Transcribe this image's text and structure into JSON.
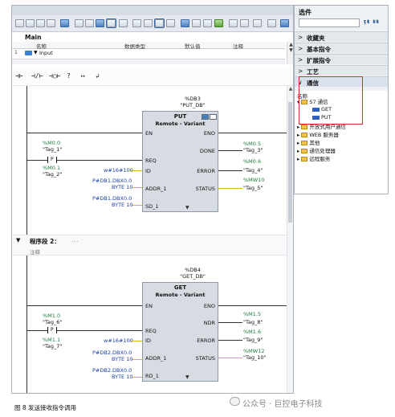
{
  "editor": {
    "section_label": "Main",
    "columns": [
      "名称",
      "数据类型",
      "默认值",
      "注释"
    ],
    "row": {
      "num": "1",
      "name": "Input"
    },
    "ladder_tools": [
      "⊣⊢",
      "⊣/⊢",
      "⊣○⊢",
      "?",
      "↦",
      "↲"
    ]
  },
  "network1": {
    "block": {
      "db_addr": "%DB3",
      "db_name": "\"PUT_DB\"",
      "title": "PUT",
      "subtitle": "Remote - Variant",
      "in_pins": [
        "EN",
        "REQ",
        "ID",
        "ADDR_1",
        "SD_1"
      ],
      "out_pins": [
        "ENO",
        "DONE",
        "ERROR",
        "STATUS"
      ]
    },
    "contact_addr": "%M0.0",
    "contact_tag": "\"Tag_1\"",
    "id_addr": "%M0.1",
    "id_tag": "\"Tag_2\"",
    "id_value": "w#16#100",
    "addr_ptr": "P#DB1.DBX0.0",
    "addr_ptr2": "BYTE 10",
    "sd_ptr": "P#DB1.DBX0.0",
    "sd_ptr2": "BYTE 10",
    "done_addr": "%M0.5",
    "done_tag": "\"Tag_3\"",
    "error_addr": "%M0.6",
    "error_tag": "\"Tag_4\"",
    "status_addr": "%MW10",
    "status_tag": "\"Tag_5\""
  },
  "segment2": {
    "label": "程序段 2：",
    "dots": "....",
    "comment": "注释"
  },
  "network2": {
    "block": {
      "db_addr": "%DB4",
      "db_name": "\"GET_DB\"",
      "title": "GET",
      "subtitle": "Remote - Variant",
      "in_pins": [
        "EN",
        "REQ",
        "ID",
        "ADDR_1",
        "RD_1"
      ],
      "out_pins": [
        "ENO",
        "NDR",
        "ERROR",
        "STATUS"
      ]
    },
    "contact_addr": "%M1.0",
    "contact_tag": "\"Tag_6\"",
    "id_addr": "%M1.1",
    "id_tag": "\"Tag_7\"",
    "id_value": "w#16#100",
    "addr_ptr": "P#DB2.DBX0.0",
    "addr_ptr2": "BYTE 10",
    "rd_ptr": "P#DB2.DBX0.0",
    "rd_ptr2": "BYTE 10",
    "ndr_addr": "%M1.5",
    "ndr_tag": "\"Tag_8\"",
    "error_addr": "%M1.6",
    "error_tag": "\"Tag_9\"",
    "status_addr": "%MW12",
    "status_tag": "\"Tag_10\""
  },
  "panel": {
    "title": "选件",
    "sections": [
      "收藏夹",
      "基本指令",
      "扩展指令",
      "工艺",
      "通信"
    ],
    "tree_header": "名称",
    "tree": {
      "s7": "S7 通信",
      "get": "GET",
      "put": "PUT",
      "open_user": "开放式用户通信",
      "web": "WEB 服务器",
      "other": "其他",
      "comm_proc": "通信处理器",
      "teleservice": "远程服务"
    }
  },
  "caption": "图 8 发送接收指令调用",
  "watermark": "公众号 · 巨控电子科技"
}
